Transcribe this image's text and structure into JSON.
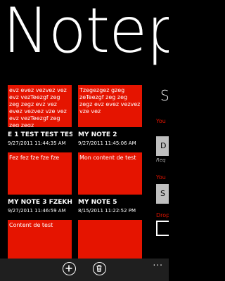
{
  "app": {
    "title": "Notepad"
  },
  "notes": [
    {
      "preview": "evz evez vezvez vez evz vezTeezgf zeg zeg zegz evz vez evez vezvez vze vez evz vezTeezgf zeg zeg zegz",
      "title": "E 1 TEST TEST TES",
      "date": "9/27/2011 11:44:35 AM"
    },
    {
      "preview": "Tzegezgez gzeg zeTeezgf zeg zeg zegz evz evez vezvez vze vez",
      "title": "MY NOTE 2",
      "date": "9/27/2011 11:45:06 AM"
    },
    {
      "preview": "Fez fez fze fze fze",
      "title": "MY NOTE 3 FZEKH",
      "date": "9/27/2011 11:46:59 AM"
    },
    {
      "preview": "Mon content de test",
      "title": "MY NOTE 5",
      "date": "8/15/2011 11:22:52 PM"
    },
    {
      "preview": "Content de test",
      "title": "",
      "date": ""
    },
    {
      "preview": "",
      "title": "",
      "date": ""
    }
  ],
  "side_panel": {
    "header": "S",
    "label_1": "You",
    "input_1": "D",
    "hint": "Req",
    "label_2": "You",
    "input_2": "S",
    "label_3": "Drop"
  },
  "appbar": {
    "add_icon": "plus-circle",
    "delete_icon": "trash-can",
    "more_label": "..."
  },
  "colors": {
    "accent": "#e51400",
    "background": "#000000",
    "appbar": "#1f1f1f"
  }
}
